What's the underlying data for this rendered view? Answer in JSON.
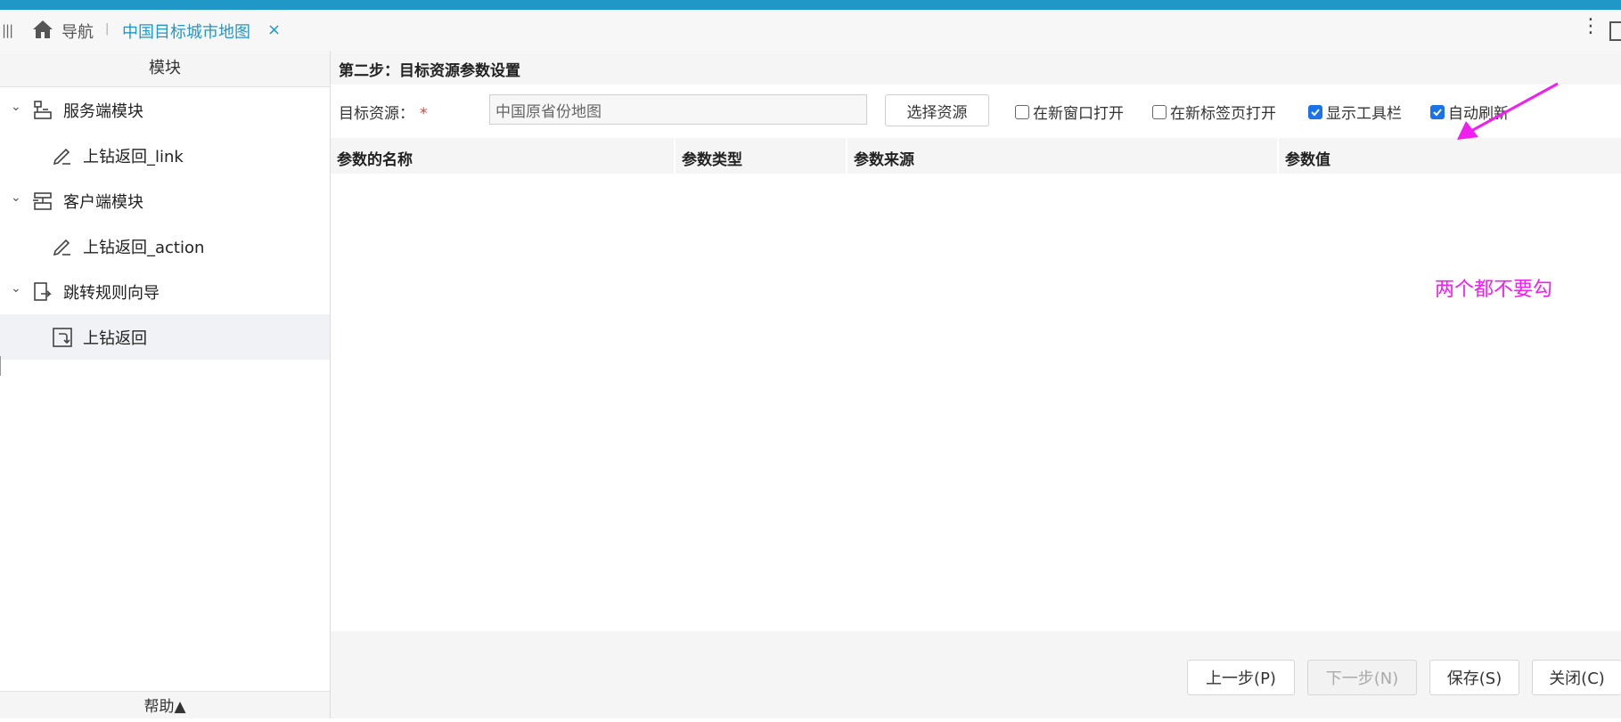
{
  "tabbar": {
    "nav_label": "导航",
    "separator": "|",
    "active_tab": "中国目标城市地图",
    "close_glyph": "×",
    "more_glyph": "⋮"
  },
  "sidebar": {
    "header": "模块",
    "items": [
      {
        "label": "服务端模块",
        "icon": "server-module-icon",
        "level": 0,
        "expanded": true
      },
      {
        "label": "上钻返回_link",
        "icon": "edit-pen-icon",
        "level": 1
      },
      {
        "label": "客户端模块",
        "icon": "client-module-icon",
        "level": 0,
        "expanded": true
      },
      {
        "label": "上钻返回_action",
        "icon": "edit-pen-icon",
        "level": 1
      },
      {
        "label": "跳转规则向导",
        "icon": "wizard-icon",
        "level": 0,
        "expanded": true
      },
      {
        "label": "上钻返回",
        "icon": "return-icon",
        "level": 1,
        "selected": true
      }
    ],
    "footer": "帮助▲"
  },
  "main": {
    "step_title": "第二步：目标资源参数设置",
    "target_label": "目标资源：",
    "required_mark": "*",
    "target_value": "中国原省份地图",
    "select_button": "选择资源",
    "options": [
      {
        "label": "在新窗口打开",
        "checked": false
      },
      {
        "label": "在新标签页打开",
        "checked": false
      },
      {
        "label": "显示工具栏",
        "checked": true
      },
      {
        "label": "自动刷新",
        "checked": true
      }
    ],
    "table_headers": [
      "参数的名称",
      "参数类型",
      "参数来源",
      "参数值"
    ],
    "annotation": "两个都不要勾",
    "accent_color": "#f01ef0"
  },
  "footer_buttons": {
    "prev": "上一步(P)",
    "next": "下一步(N)",
    "save": "保存(S)",
    "close": "关闭(C)"
  },
  "colors": {
    "brand": "#1f98c7",
    "checkbox_on": "#1a73e8",
    "annotation": "#f01ef0"
  }
}
